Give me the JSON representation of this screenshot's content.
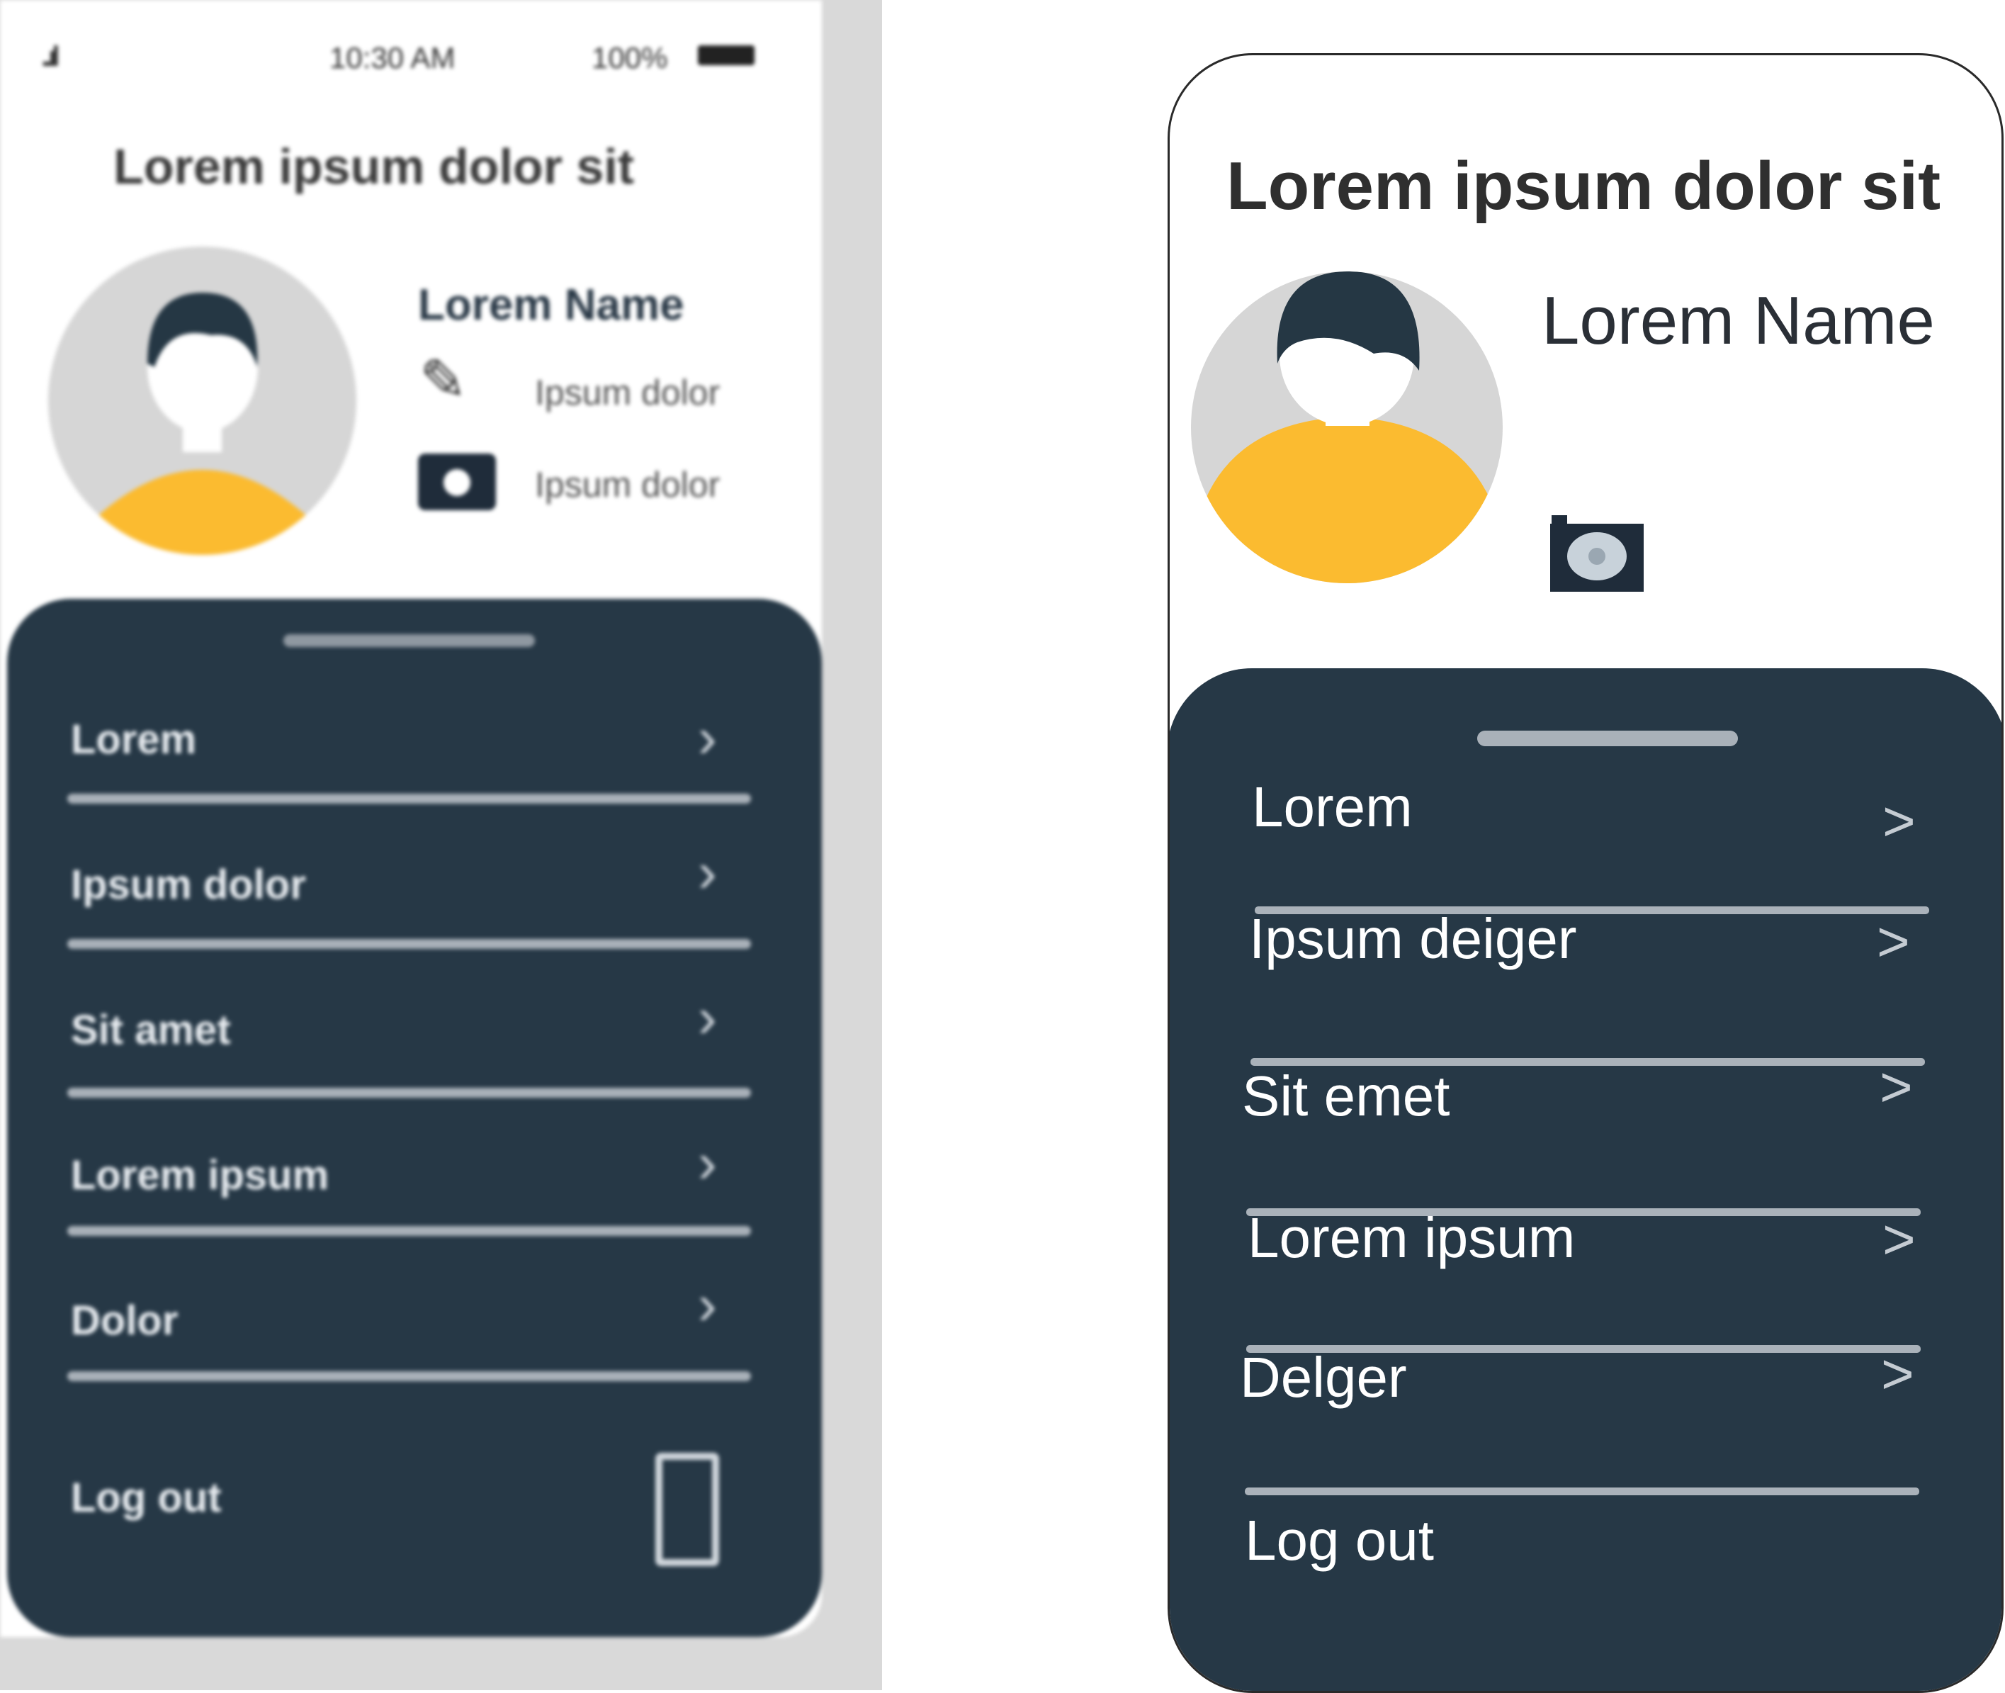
{
  "reference_mockup": {
    "status_bar": {
      "signal": "..ıl",
      "time": "10:30 AM",
      "battery": "100%"
    },
    "title": "Lorem ipsum dolor sit",
    "profile": {
      "name": "Lorem Name",
      "edit_label": "Ipsum dolor",
      "camera_label": "Ipsum dolor"
    },
    "menu": [
      {
        "label": "Lorem"
      },
      {
        "label": "Ipsum dolor"
      },
      {
        "label": "Sit amet"
      },
      {
        "label": "Lorem ipsum"
      },
      {
        "label": "Dolor"
      }
    ],
    "logout_label": "Log out"
  },
  "recreation": {
    "title": "Lorem ipsum dolor sit",
    "profile": {
      "name": "Lorem Name",
      "camera_icon": "camera-icon"
    },
    "menu": [
      {
        "label": "Lorem",
        "chevron": ">"
      },
      {
        "label": "Ipsum deiger",
        "chevron": ">"
      },
      {
        "label": "Sit emet",
        "chevron": ">"
      },
      {
        "label": "Lorem ipsum",
        "chevron": ">"
      },
      {
        "label": "Delger",
        "chevron": ">"
      }
    ],
    "logout_label": "Log out"
  },
  "colors": {
    "sheet": "#263846",
    "avatar_bg": "#d6d6d6",
    "shirt": "#fbbb30",
    "hair": "#253744",
    "divider": "#aab2ba"
  }
}
